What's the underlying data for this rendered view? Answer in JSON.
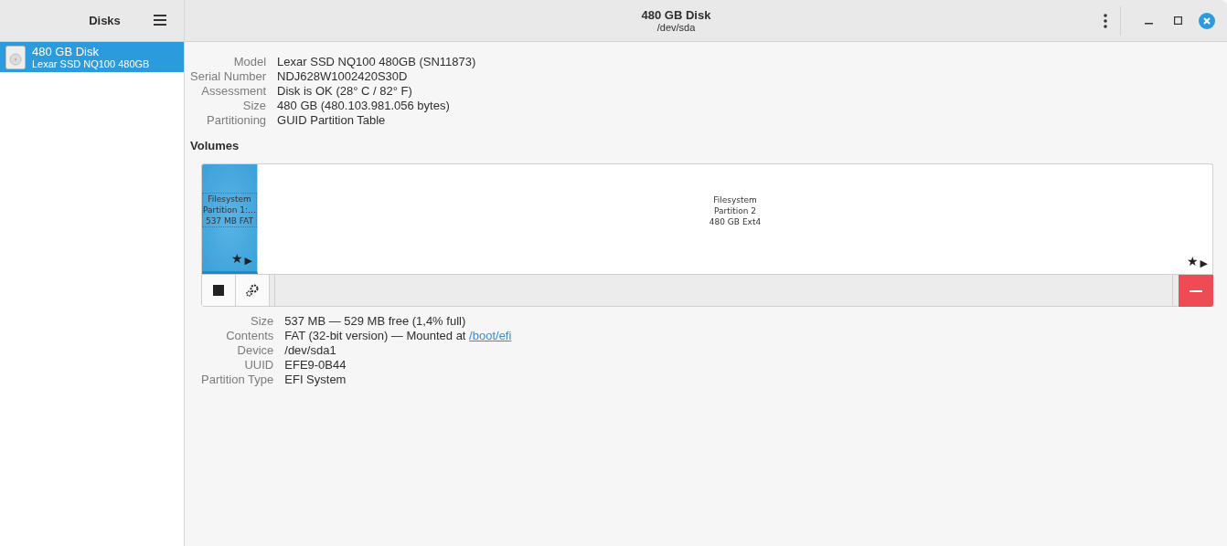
{
  "sidebar": {
    "title": "Disks",
    "items": [
      {
        "name": "480 GB Disk",
        "description": "Lexar SSD NQ100 480GB",
        "selected": true
      }
    ]
  },
  "window": {
    "title": "480 GB Disk",
    "subtitle": "/dev/sda"
  },
  "disk_info": [
    {
      "label": "Model",
      "value": "Lexar SSD NQ100 480GB (SN11873)"
    },
    {
      "label": "Serial Number",
      "value": "NDJ628W1002420S30D"
    },
    {
      "label": "Assessment",
      "value": "Disk is OK (28° C / 82° F)"
    },
    {
      "label": "Size",
      "value": "480 GB (480.103.981.056 bytes)"
    },
    {
      "label": "Partitioning",
      "value": "GUID Partition Table"
    }
  ],
  "volumes": {
    "heading": "Volumes",
    "partitions": [
      {
        "lines": [
          "Filesystem",
          "Partition 1:…",
          "537 MB FAT"
        ],
        "badges": [
          "★",
          "▶"
        ],
        "selected": true
      },
      {
        "lines": [
          "Filesystem",
          "Partition 2",
          "480 GB Ext4"
        ],
        "badges": [
          "★",
          "▶"
        ],
        "selected": false
      }
    ]
  },
  "volume_info": [
    {
      "label": "Size",
      "value": "537 MB — 529 MB free (1,4% full)"
    },
    {
      "label": "Contents",
      "value": "FAT (32-bit version) — Mounted at",
      "link": "/boot/efi"
    },
    {
      "label": "Device",
      "value": "/dev/sda1"
    },
    {
      "label": "UUID",
      "value": "EFE9-0B44"
    },
    {
      "label": "Partition Type",
      "value": "EFI System"
    }
  ]
}
